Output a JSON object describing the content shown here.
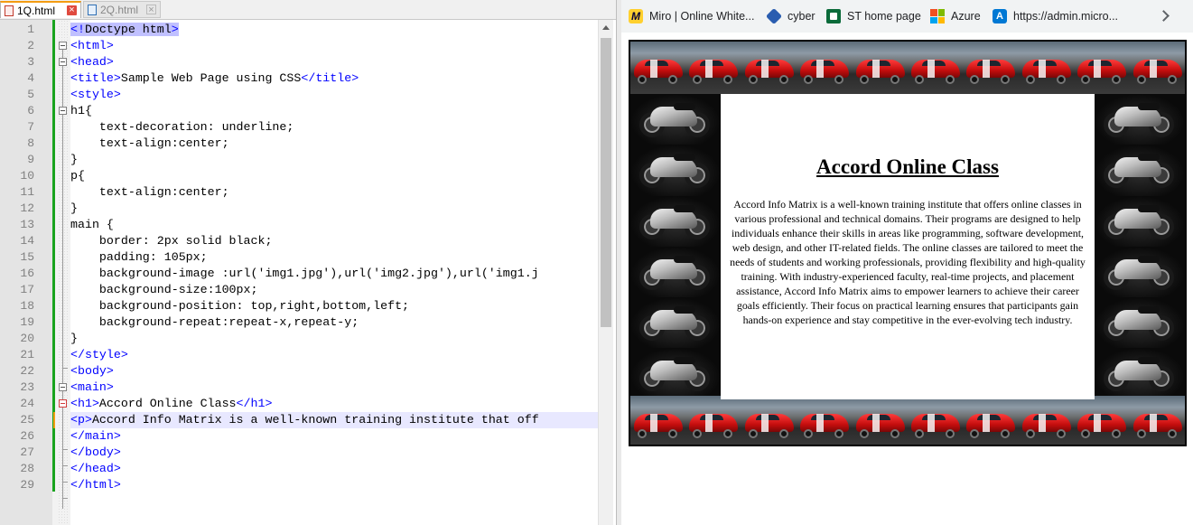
{
  "editor": {
    "tabs": [
      {
        "label": "1Q.html",
        "active": true
      },
      {
        "label": "2Q.html",
        "active": false
      }
    ],
    "line_numbers": [
      "1",
      "2",
      "3",
      "4",
      "5",
      "6",
      "7",
      "8",
      "9",
      "10",
      "11",
      "12",
      "13",
      "14",
      "15",
      "16",
      "17",
      "18",
      "19",
      "20",
      "21",
      "22",
      "23",
      "24",
      "25",
      "26",
      "27",
      "28",
      "29"
    ],
    "code": {
      "l1_a": "<!",
      "l1_b": "Doctype html",
      "l1_c": ">",
      "l2": "<html>",
      "l3": "<head>",
      "l4_a": "<title>",
      "l4_b": "Sample Web Page using CSS",
      "l4_c": "</title>",
      "l5": "<style>",
      "l6": "h1{",
      "l7": "    text-decoration: underline;",
      "l8": "    text-align:center;",
      "l9": "}",
      "l10": "p{",
      "l11": "    text-align:center;",
      "l12": "}",
      "l13": "main {",
      "l14": "    border: 2px solid black;",
      "l15": "    padding: 105px;",
      "l16": "    background-image :url('img1.jpg'),url('img2.jpg'),url('img1.j",
      "l17": "    background-size:100px;",
      "l18": "    background-position: top,right,bottom,left;",
      "l19": "    background-repeat:repeat-x,repeat-y;",
      "l20": "}",
      "l21": "</style>",
      "l22": "<body>",
      "l23": "<main>",
      "l24_a": "<h1>",
      "l24_b": "Accord Online Class",
      "l24_c": "</h1>",
      "l25_a": "<p>",
      "l25_b": "Accord Info Matrix is a well-known training institute that off",
      "l26": "</main>",
      "l27": "</body>",
      "l28": "</head>",
      "l29": "</html>"
    }
  },
  "browser": {
    "bookmarks": [
      {
        "label": "Miro | Online White...",
        "icon": "miro-icon"
      },
      {
        "label": "cyber",
        "icon": "cyber-icon"
      },
      {
        "label": "ST home page",
        "icon": "st-icon"
      },
      {
        "label": "Azure",
        "icon": "azure-icon"
      },
      {
        "label": "https://admin.micro...",
        "icon": "admin-icon"
      }
    ],
    "page": {
      "heading": "Accord Online Class",
      "paragraph": "Accord Info Matrix is a well-known training institute that offers online classes in various professional and technical domains. Their programs are designed to help individuals enhance their skills in areas like programming, software development, web design, and other IT-related fields. The online classes are tailored to meet the needs of students and working professionals, providing flexibility and high-quality training. With industry-experienced faculty, real-time projects, and placement assistance, Accord Info Matrix aims to empower learners to achieve their career goals efficiently. Their focus on practical learning ensures that participants gain hands-on experience and stay competitive in the ever-evolving tech industry."
    }
  },
  "colors": {
    "tag_blue": "#0000ff",
    "change_bar": "#19a31e",
    "current_line": "#e8e8ff",
    "active_tab_accent": "#f39c12"
  }
}
